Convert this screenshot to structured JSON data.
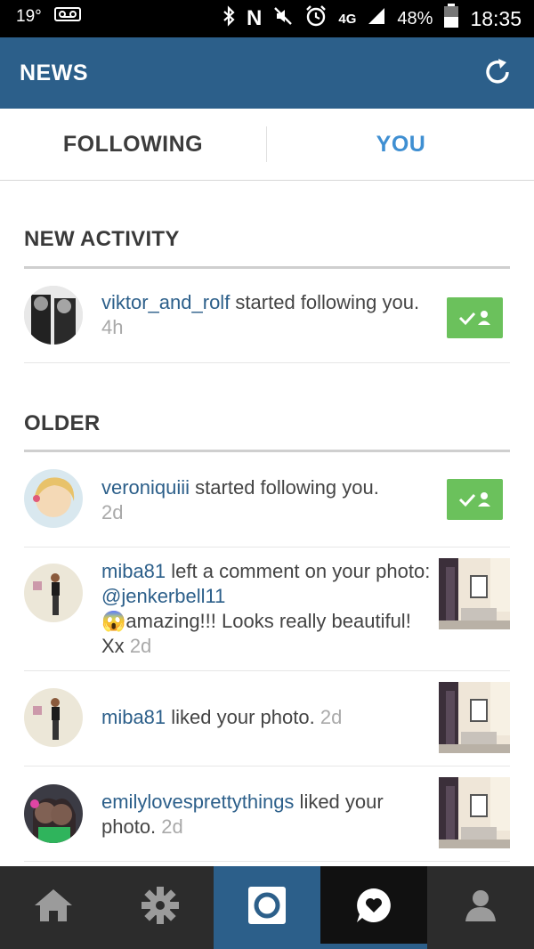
{
  "status_bar": {
    "temperature": "19°",
    "network": "4G",
    "battery": "48%",
    "time": "18:35"
  },
  "header": {
    "title": "NEWS",
    "refresh_icon": "refresh-icon"
  },
  "tabs": [
    {
      "label": "FOLLOWING",
      "active": false
    },
    {
      "label": "YOU",
      "active": true
    }
  ],
  "sections": {
    "new_activity": "NEW ACTIVITY",
    "older": "OLDER"
  },
  "items": [
    {
      "user": "viktor_and_rolf",
      "text": " started following you.",
      "time": "4h",
      "action": "follow-back"
    },
    {
      "user": "veroniquiii",
      "text": " started following you.",
      "time": "2d",
      "action": "follow-back"
    },
    {
      "user": "miba81",
      "text_a": " left a comment on your photo: ",
      "mention": "@jenkerbell11",
      "text_b": "amazing!!! Looks really beautiful! Xx",
      "time": "2d",
      "emoji": "😱"
    },
    {
      "user": "miba81",
      "text": " liked your photo.",
      "time": "2d"
    },
    {
      "user": "emilylovesprettythings",
      "text": " liked your photo.",
      "time": "2d"
    }
  ],
  "nav": {
    "items": [
      "home-icon",
      "explore-icon",
      "camera-icon",
      "news-icon",
      "profile-icon"
    ],
    "active": "news-icon"
  },
  "colors": {
    "header": "#2c5f8a",
    "accent": "#3f8fd2",
    "follow_button": "#6bc15c",
    "nav_bg": "#2c2c2c"
  }
}
